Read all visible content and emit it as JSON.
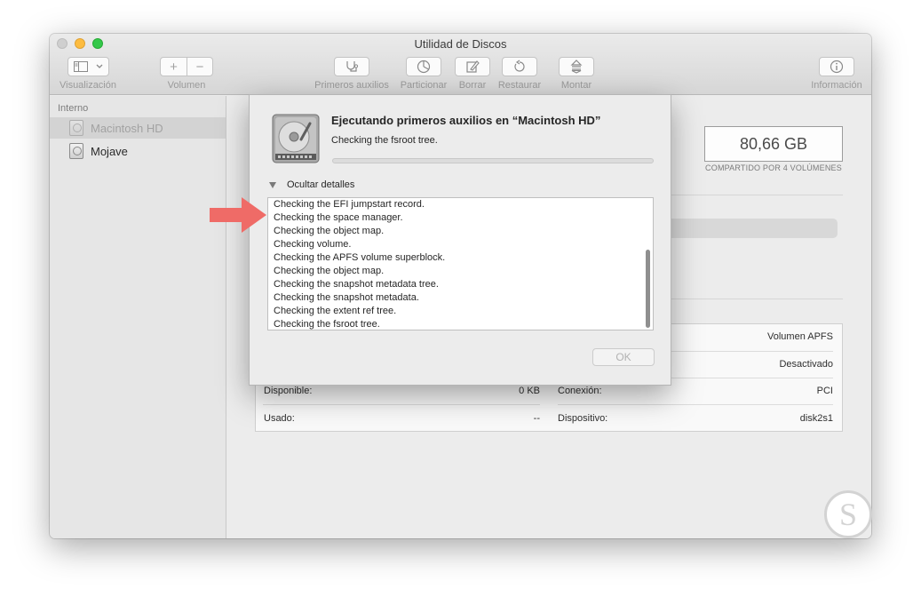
{
  "window": {
    "title": "Utilidad de Discos"
  },
  "toolbar": {
    "view_label": "Visualización",
    "volume_label": "Volumen",
    "volume_add": "+",
    "volume_remove": "−",
    "firstaid_label": "Primeros auxilios",
    "partition_label": "Particionar",
    "erase_label": "Borrar",
    "restore_label": "Restaurar",
    "mount_label": "Montar",
    "info_label": "Información"
  },
  "sidebar": {
    "header": "Interno",
    "items": [
      {
        "label": "Macintosh HD"
      },
      {
        "label": "Mojave"
      }
    ]
  },
  "main": {
    "capacity": "80,66 GB",
    "capacity_sub": "COMPARTIDO POR 4 VOLÚMENES",
    "info": {
      "type_value": "Volumen APFS",
      "owners_value": "Desactivado",
      "available_label": "Disponible:",
      "available_value": "0 KB",
      "connection_label": "Conexión:",
      "connection_value": "PCI",
      "used_label": "Usado:",
      "used_value": "--",
      "device_label": "Dispositivo:",
      "device_value": "disk2s1"
    }
  },
  "dialog": {
    "title": "Ejecutando primeros auxilios en “Macintosh HD”",
    "status": "Checking the fsroot tree.",
    "disclosure": "Ocultar detalles",
    "log": [
      "Checking the EFI jumpstart record.",
      "Checking the space manager.",
      "Checking the object map.",
      "Checking volume.",
      "Checking the APFS volume superblock.",
      "Checking the object map.",
      "Checking the snapshot metadata tree.",
      "Checking the snapshot metadata.",
      "Checking the extent ref tree.",
      "Checking the fsroot tree."
    ],
    "ok_label": "OK"
  },
  "colors": {
    "arrow": "#ef6b67",
    "traffic_min": "#fdbc40",
    "traffic_max": "#34c84a"
  },
  "icons": [
    "sidebar-view-icon",
    "chevron-down-icon",
    "stethoscope-icon",
    "pie-partition-icon",
    "eraser-icon",
    "restore-icon",
    "mount-icon",
    "info-icon",
    "hard-drive-icon",
    "disclosure-triangle-icon",
    "arrow-right-icon"
  ]
}
